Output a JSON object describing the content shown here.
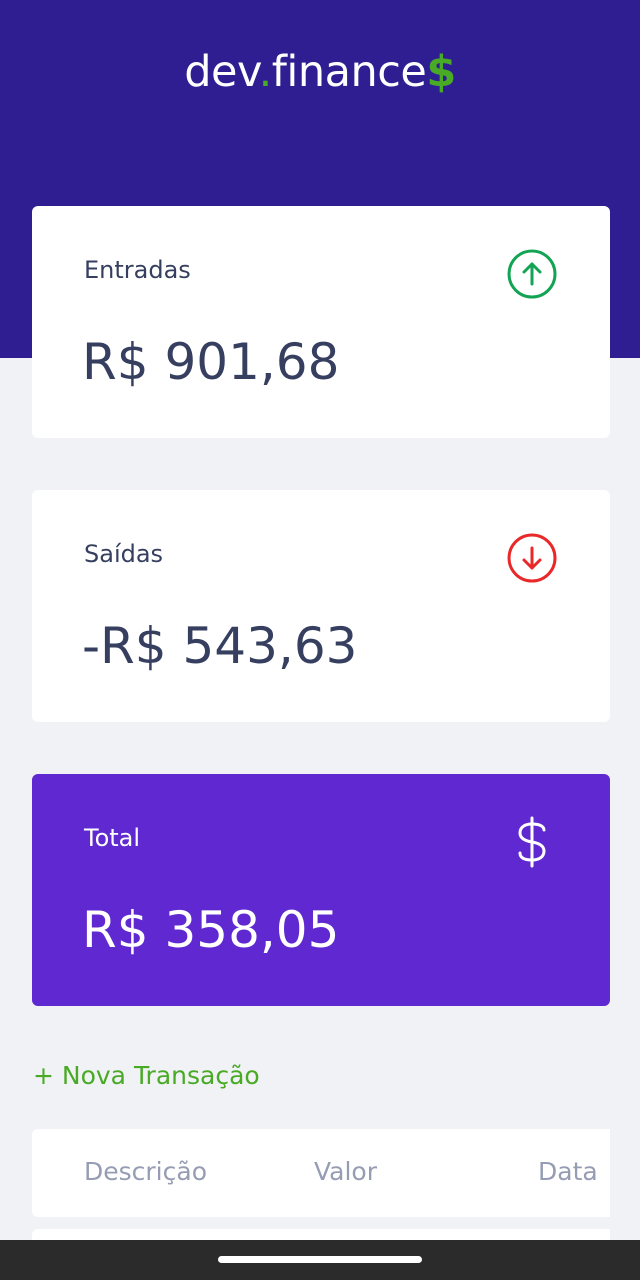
{
  "app": {
    "logo_part1": "dev",
    "logo_dot": ".",
    "logo_part2": "finance",
    "logo_dollar": "$"
  },
  "cards": {
    "income": {
      "label": "Entradas",
      "amount": "R$ 901,68",
      "icon": "arrow-up-circle-icon",
      "color": "#12A454"
    },
    "expense": {
      "label": "Saídas",
      "amount": "-R$ 543,63",
      "icon": "arrow-down-circle-icon",
      "color": "#E92929"
    },
    "total": {
      "label": "Total",
      "amount": "R$ 358,05",
      "icon": "dollar-icon",
      "color": "#5F28D1"
    }
  },
  "actions": {
    "new_transaction": "+ Nova Transação"
  },
  "table": {
    "columns": [
      "Descrição",
      "Valor",
      "Data"
    ]
  },
  "colors": {
    "header": "#2F1D92",
    "accent_green": "#49AA26",
    "background": "#F0F2F5"
  }
}
